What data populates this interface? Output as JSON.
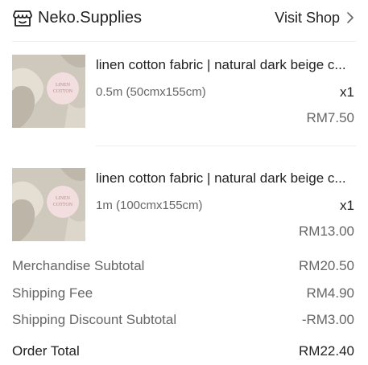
{
  "shop": {
    "name": "Neko.Supplies",
    "icon": "shop-icon",
    "visit_label": "Visit Shop",
    "visit_icon": "chevron-right-icon"
  },
  "items": [
    {
      "name": "linen cotton fabric | natural dark beige c...",
      "variation": "0.5m (50cmx155cm)",
      "quantity": "x1",
      "price": "RM7.50",
      "thumbnail_text": [
        "LINEN",
        "COTTON"
      ]
    },
    {
      "name": "linen cotton fabric | natural dark beige c...",
      "variation": "1m (100cmx155cm)",
      "quantity": "x1",
      "price": "RM13.00",
      "thumbnail_text": [
        "LINEN",
        "COTTON"
      ]
    }
  ],
  "summary": {
    "merchandise_subtotal_label": "Merchandise Subtotal",
    "merchandise_subtotal_value": "RM20.50",
    "shipping_fee_label": "Shipping Fee",
    "shipping_fee_value": "RM4.90",
    "shipping_discount_label": "Shipping Discount Subtotal",
    "shipping_discount_value": "-RM3.00",
    "order_total_label": "Order Total",
    "order_total_value": "RM22.40"
  },
  "colors": {
    "text_primary": "#222222",
    "text_secondary": "#666666",
    "divider": "#ededed",
    "thumb_bg": "#cfc8bd",
    "thumb_label_bg": "#f2dede",
    "thumb_label_text": "#b98a8a"
  }
}
